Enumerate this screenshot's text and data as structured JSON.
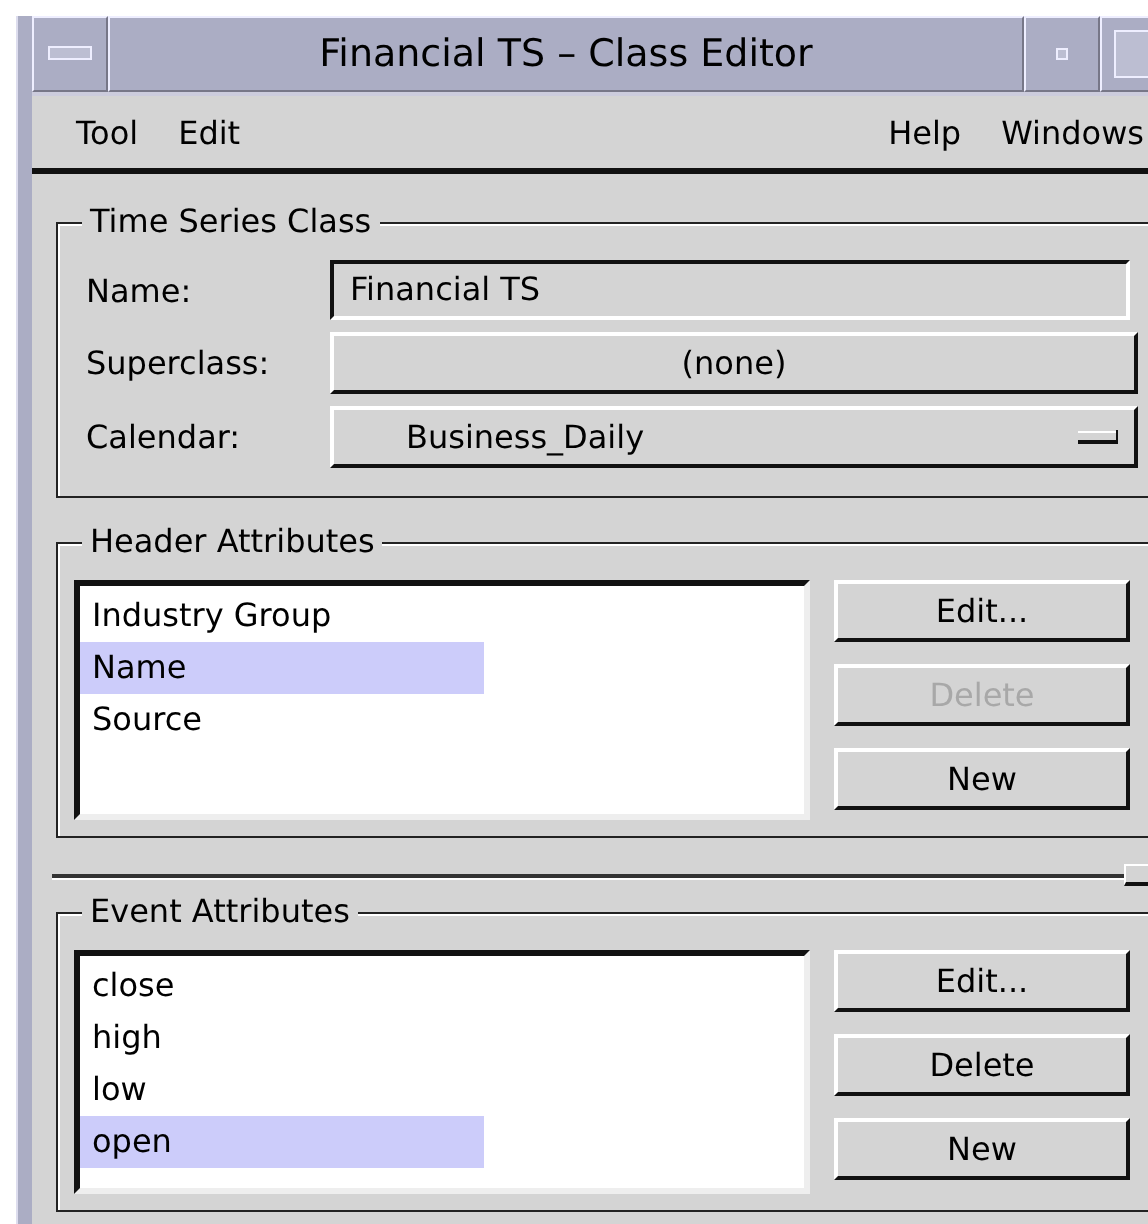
{
  "window": {
    "title": "Financial TS – Class Editor"
  },
  "menu_bar": {
    "left": [
      {
        "label": "Tool"
      },
      {
        "label": "Edit"
      }
    ],
    "right": [
      {
        "label": "Help"
      },
      {
        "label": "Windows"
      }
    ]
  },
  "time_series_class": {
    "title": "Time Series Class",
    "name_label": "Name:",
    "name_value": "Financial TS",
    "superclass_label": "Superclass:",
    "superclass_value": "(none)",
    "calendar_label": "Calendar:",
    "calendar_value": "Business_Daily"
  },
  "header_attributes": {
    "title": "Header Attributes",
    "items": [
      {
        "label": "Industry Group",
        "selected": false
      },
      {
        "label": "Name",
        "selected": true
      },
      {
        "label": "Source",
        "selected": false
      }
    ],
    "buttons": [
      {
        "label": "Edit...",
        "disabled": false
      },
      {
        "label": "Delete",
        "disabled": true
      },
      {
        "label": "New",
        "disabled": false
      }
    ]
  },
  "event_attributes": {
    "title": "Event Attributes",
    "items": [
      {
        "label": "close",
        "selected": false
      },
      {
        "label": "high",
        "selected": false
      },
      {
        "label": "low",
        "selected": false
      },
      {
        "label": "open",
        "selected": true
      }
    ],
    "buttons": [
      {
        "label": "Edit...",
        "disabled": false
      },
      {
        "label": "Delete",
        "disabled": false
      },
      {
        "label": "New",
        "disabled": false
      }
    ]
  }
}
